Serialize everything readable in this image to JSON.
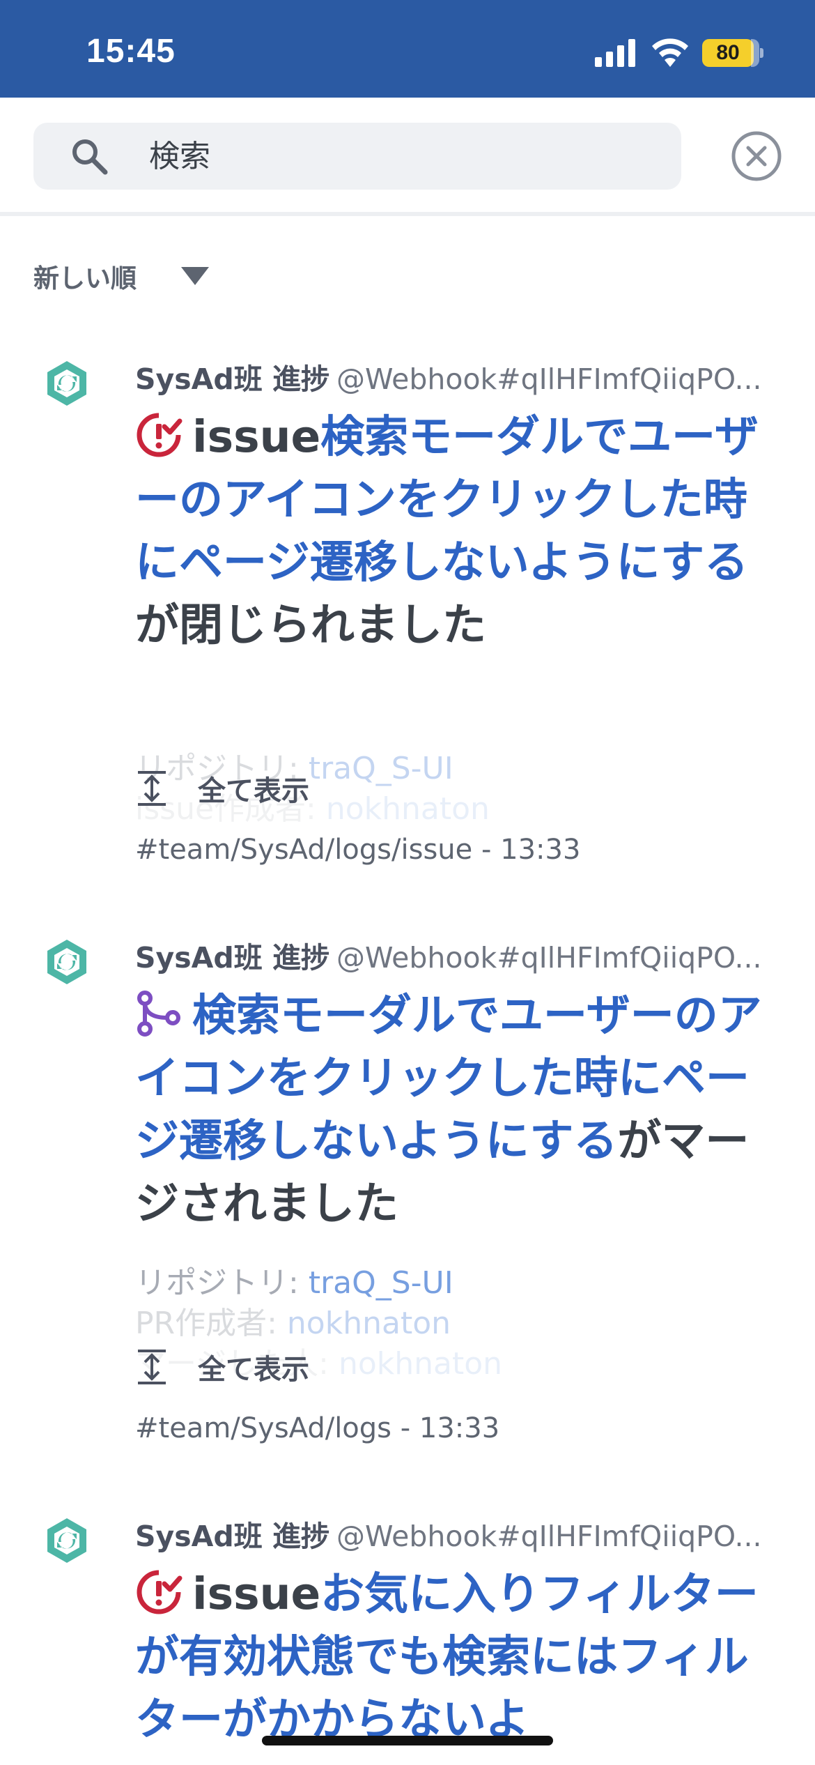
{
  "status_bar": {
    "time": "15:45",
    "battery": "80",
    "icons": [
      "signal-icon",
      "wifi-icon",
      "battery-icon"
    ],
    "battery_color": "#f5cf2b"
  },
  "search": {
    "placeholder": "検索",
    "icon": "search-icon",
    "clear_icon": "close-circle-icon"
  },
  "sort": {
    "label": "新しい順",
    "icon": "caret-down-icon"
  },
  "colors": {
    "header": "#2b5aa3",
    "link": "#2d63c4",
    "issue_closed": "#c9253b",
    "merged": "#7d4ec2",
    "avatar": "#4db6a6"
  },
  "results": [
    {
      "user_name": "SysAd班 進捗",
      "user_id": "@Webhook#qIlHFImfQiiqPO...",
      "status_icon": "issue-closed-icon",
      "title_prefix": "issue",
      "title_link": "検索モーダルでユーザーのアイコンをクリックした時にページ遷移しないようにする",
      "title_suffix": "が閉じられました",
      "details": [
        {
          "label": "リポジトリ: ",
          "value": "traQ_S-UI"
        },
        {
          "label": "issue作成者: ",
          "value": "nokhnaton"
        }
      ],
      "show_all": "全て表示",
      "channel": "#team/SysAd/logs/issue",
      "time": "13:33"
    },
    {
      "user_name": "SysAd班 進捗",
      "user_id": "@Webhook#qIlHFImfQiiqPO...",
      "status_icon": "pull-request-merged-icon",
      "title_prefix": "",
      "title_link": "検索モーダルでユーザーのアイコンをクリックした時にページ遷移しないようにする",
      "title_suffix": "がマージされました",
      "details": [
        {
          "label": "リポジトリ: ",
          "value": "traQ_S-UI"
        },
        {
          "label": "PR作成者: ",
          "value": "nokhnaton"
        },
        {
          "label": "マージした人: ",
          "value": "nokhnaton"
        }
      ],
      "show_all": "全て表示",
      "channel": "#team/SysAd/logs",
      "time": "13:33"
    },
    {
      "user_name": "SysAd班 進捗",
      "user_id": "@Webhook#qIlHFImfQiiqPO...",
      "status_icon": "issue-closed-icon",
      "title_prefix": "issue",
      "title_link": "お気に入りフィルターが有効状態でも検索にはフィルターがかからないよ"
    }
  ],
  "separator": " - "
}
